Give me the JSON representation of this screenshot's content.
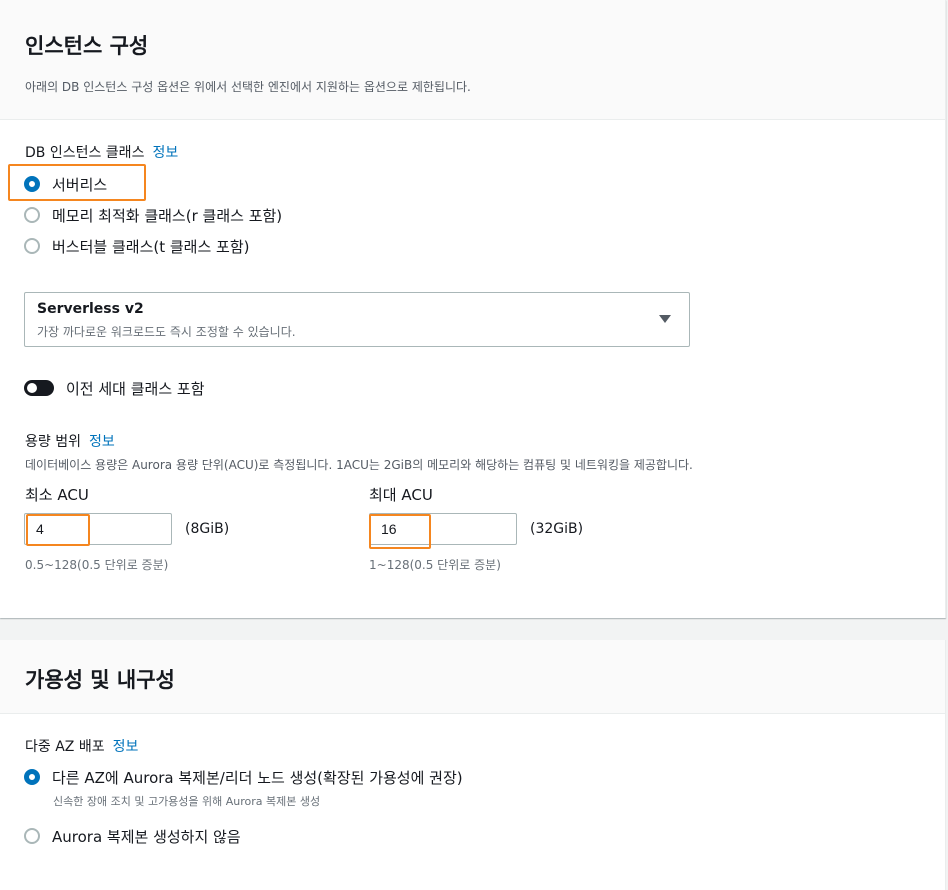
{
  "instance_config": {
    "title": "인스턴스 구성",
    "description": "아래의 DB 인스턴스 구성 옵션은 위에서 선택한 엔진에서 지원하는 옵션으로 제한됩니다.",
    "class_label": "DB 인스턴스 클래스",
    "info_link": "정보",
    "class_options": [
      {
        "label": "서버리스",
        "selected": true
      },
      {
        "label": "메모리 최적화 클래스(r 클래스 포함)",
        "selected": false
      },
      {
        "label": "버스터블 클래스(t 클래스 포함)",
        "selected": false
      }
    ],
    "select": {
      "value": "Serverless v2",
      "description": "가장 까다로운 워크로드도 즉시 조정할 수 있습니다."
    },
    "toggle_label": "이전 세대 클래스 포함",
    "toggle_on": false,
    "capacity": {
      "label": "용량 범위",
      "info_link": "정보",
      "description": "데이터베이스 용량은 Aurora 용량 단위(ACU)로 측정됩니다. 1ACU는 2GiB의 메모리와 해당하는 컴퓨팅 및 네트워킹을 제공합니다.",
      "min": {
        "label": "최소 ACU",
        "value": "4",
        "unit": "(8GiB)",
        "hint": "0.5~128(0.5 단위로 증분)"
      },
      "max": {
        "label": "최대 ACU",
        "value": "16",
        "unit": "(32GiB)",
        "hint": "1~128(0.5 단위로 증분)"
      }
    }
  },
  "availability": {
    "title": "가용성 및 내구성",
    "multi_az_label": "다중 AZ 배포",
    "info_link": "정보",
    "options": [
      {
        "label": "다른 AZ에 Aurora 복제본/리더 노드 생성(확장된 가용성에 권장)",
        "description": "신속한 장애 조치 및 고가용성을 위해 Aurora 복제본 생성",
        "selected": true
      },
      {
        "label": "Aurora 복제본 생성하지 않음",
        "selected": false
      }
    ]
  },
  "colors": {
    "accent": "#0073bb",
    "highlight": "#f5861f"
  }
}
